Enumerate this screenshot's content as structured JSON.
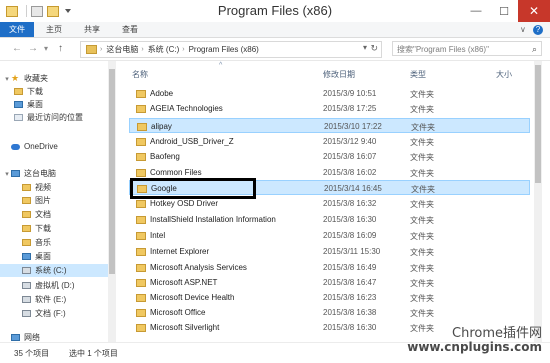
{
  "window": {
    "title": "Program Files (x86)",
    "controls": {
      "minimize": "—",
      "maximize": "☐",
      "close": "✕"
    }
  },
  "ribbon": {
    "tabs": [
      "文件",
      "主页",
      "共享",
      "查看"
    ],
    "help": "?",
    "collapse": "∨"
  },
  "navigation": {
    "back": "←",
    "forward": "→",
    "recent": "▾",
    "up": "↑",
    "address": [
      "这台电脑",
      "系统 (C:)",
      "Program Files (x86)"
    ],
    "search_placeholder": "搜索\"Program Files (x86)\""
  },
  "sidebar": {
    "items": [
      {
        "label": "收藏夹",
        "icon": "star-icon"
      },
      {
        "label": "下载",
        "icon": "folder-icon"
      },
      {
        "label": "桌面",
        "icon": "folder-icon"
      },
      {
        "label": "最近访问的位置",
        "icon": "recent-icon"
      },
      {
        "label": "OneDrive",
        "icon": "cloud-icon"
      },
      {
        "label": "这台电脑",
        "icon": "computer-icon"
      },
      {
        "label": "视频",
        "icon": "folder-icon"
      },
      {
        "label": "图片",
        "icon": "folder-icon"
      },
      {
        "label": "文档",
        "icon": "folder-icon"
      },
      {
        "label": "下载",
        "icon": "folder-icon"
      },
      {
        "label": "音乐",
        "icon": "folder-icon"
      },
      {
        "label": "桌面",
        "icon": "folder-icon"
      },
      {
        "label": "系统 (C:)",
        "icon": "drive-icon"
      },
      {
        "label": "虚拟机 (D:)",
        "icon": "drive-icon"
      },
      {
        "label": "软件 (E:)",
        "icon": "drive-icon"
      },
      {
        "label": "文档 (F:)",
        "icon": "drive-icon"
      },
      {
        "label": "网络",
        "icon": "network-icon"
      }
    ]
  },
  "columns": {
    "name": "名称",
    "date": "修改日期",
    "type": "类型",
    "size": "大小"
  },
  "files": [
    {
      "name": "Adobe",
      "date": "2015/3/9 10:51",
      "type": "文件夹"
    },
    {
      "name": "AGEIA Technologies",
      "date": "2015/3/8 17:25",
      "type": "文件夹"
    },
    {
      "name": "alipay",
      "date": "2015/3/10 17:22",
      "type": "文件夹"
    },
    {
      "name": "Android_USB_Driver_Z",
      "date": "2015/3/12 9:40",
      "type": "文件夹"
    },
    {
      "name": "Baofeng",
      "date": "2015/3/8 16:07",
      "type": "文件夹"
    },
    {
      "name": "Common Files",
      "date": "2015/3/8 16:02",
      "type": "文件夹"
    },
    {
      "name": "Google",
      "date": "2015/3/14 16:45",
      "type": "文件夹"
    },
    {
      "name": "Hotkey OSD Driver",
      "date": "2015/3/8 16:32",
      "type": "文件夹"
    },
    {
      "name": "InstallShield Installation Information",
      "date": "2015/3/8 16:30",
      "type": "文件夹"
    },
    {
      "name": "Intel",
      "date": "2015/3/8 16:09",
      "type": "文件夹"
    },
    {
      "name": "Internet Explorer",
      "date": "2015/3/11 15:30",
      "type": "文件夹"
    },
    {
      "name": "Microsoft Analysis Services",
      "date": "2015/3/8 16:49",
      "type": "文件夹"
    },
    {
      "name": "Microsoft ASP.NET",
      "date": "2015/3/8 16:47",
      "type": "文件夹"
    },
    {
      "name": "Microsoft Device Health",
      "date": "2015/3/8 16:23",
      "type": "文件夹"
    },
    {
      "name": "Microsoft Office",
      "date": "2015/3/8 16:38",
      "type": "文件夹"
    },
    {
      "name": "Microsoft Silverlight",
      "date": "2015/3/8 16:30",
      "type": "文件夹"
    }
  ],
  "status": {
    "count": "35 个项目",
    "selected": "选中 1 个项目"
  },
  "watermark": {
    "line1": "Chrome插件网",
    "line2": "www.cnplugins.com"
  }
}
